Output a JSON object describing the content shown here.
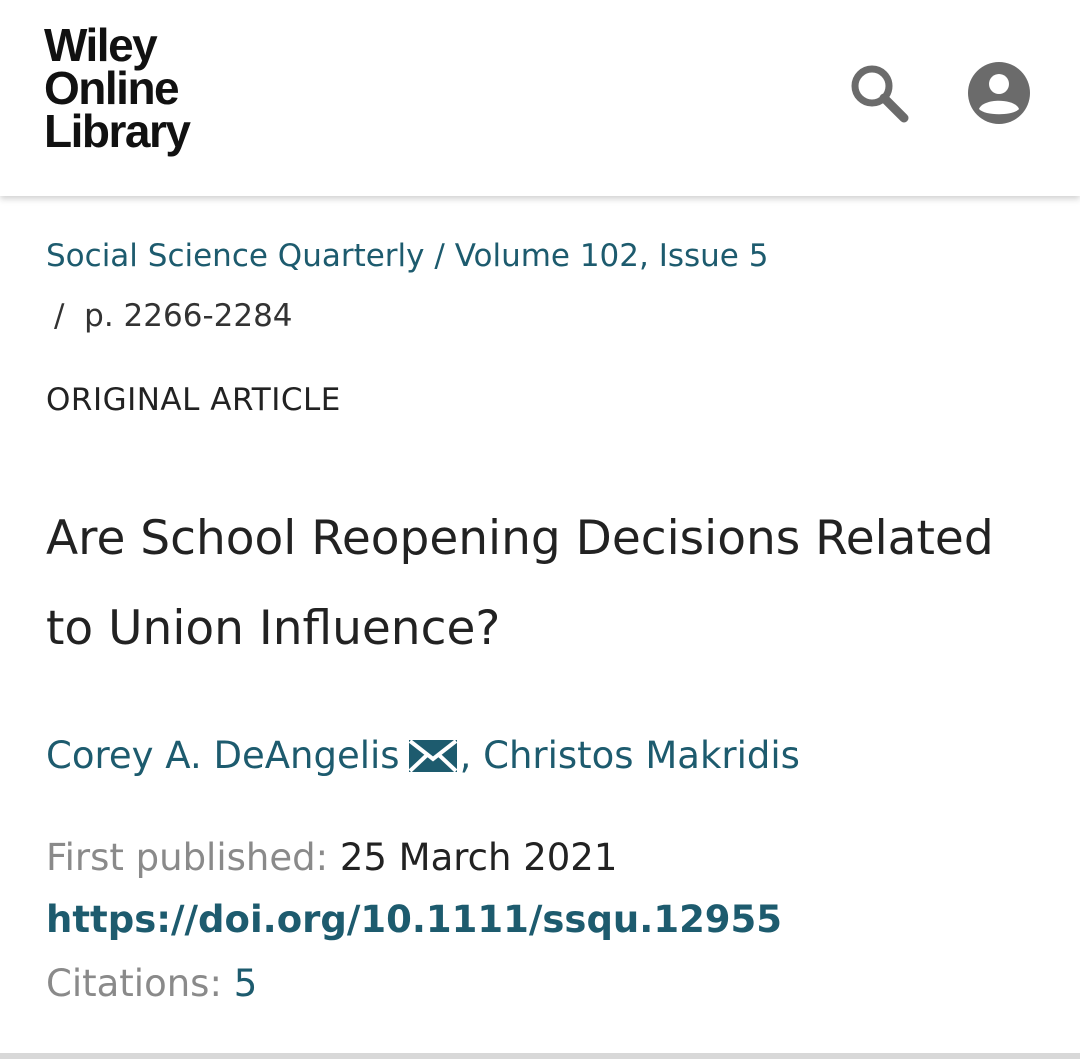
{
  "header": {
    "logo_lines": [
      "Wiley",
      "Online",
      "Library"
    ],
    "search_icon": "search-icon",
    "account_icon": "account-circle-icon",
    "icon_color": "#6b6b6b"
  },
  "article": {
    "journal": "Social Science Quarterly",
    "breadcrumb_separator": "/",
    "volume_issue": "Volume 102, Issue 5",
    "pages_separator": "/",
    "pages": "p. 2266-2284",
    "type": "ORIGINAL ARTICLE",
    "title": "Are School Reopening Decisions Related to Union Influence?",
    "authors": [
      {
        "name": "Corey A. DeAngelis",
        "has_email_icon": true
      },
      {
        "name": "Christos Makridis",
        "has_email_icon": false
      }
    ],
    "author_separator": ",",
    "first_published_label": "First published:",
    "first_published_value": "25 March 2021",
    "doi": "https://doi.org/10.1111/ssqu.12955",
    "citations_label": "Citations:",
    "citations_value": "5"
  },
  "colors": {
    "link": "#1d5b6e",
    "text": "#222222",
    "muted": "#8a8a8a"
  }
}
